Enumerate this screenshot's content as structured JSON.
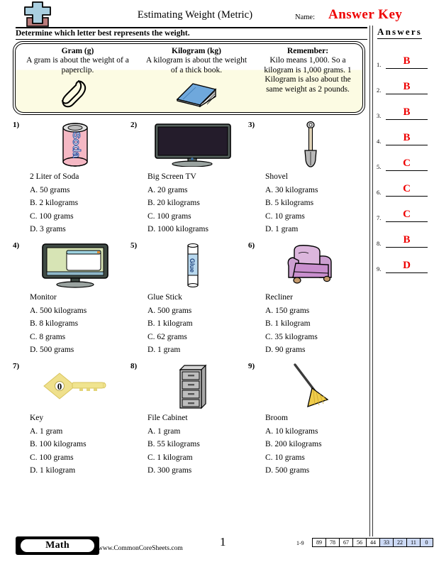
{
  "header": {
    "logo_icon": "plus-block-logo",
    "title": "Estimating Weight (Metric)",
    "name_label": "Name:",
    "answer_key_text": "Answer Key",
    "instruction": "Determine which letter best represents the weight."
  },
  "info_box": {
    "columns": [
      {
        "title": "Gram (g)",
        "text": "A gram is about the weight of a paperclip.",
        "art_icon": "paperclip-icon"
      },
      {
        "title": "Kilogram (kg)",
        "text": "A kilogram is about the weight of a thick book.",
        "art_icon": "book-icon"
      },
      {
        "title": "Remember:",
        "text": "Kilo means 1,000. So a kilogram is 1,000 grams. 1 Kilogram is also about the same weight as 2 pounds.",
        "art_icon": "none"
      }
    ]
  },
  "questions": [
    {
      "number": "1)",
      "art_icon": "soda-can-icon",
      "label": "2 Liter of Soda",
      "choices": [
        "A. 50 grams",
        "B. 2 kilograms",
        "C. 100 grams",
        "D. 3 grams"
      ]
    },
    {
      "number": "2)",
      "art_icon": "television-icon",
      "label": "Big Screen TV",
      "choices": [
        "A. 20 grams",
        "B. 20 kilograms",
        "C. 100 grams",
        "D. 1000 kilograms"
      ]
    },
    {
      "number": "3)",
      "art_icon": "shovel-icon",
      "label": "Shovel",
      "choices": [
        "A. 30 kilograms",
        "B. 5 kilograms",
        "C. 10 grams",
        "D. 1 gram"
      ]
    },
    {
      "number": "4)",
      "art_icon": "monitor-icon",
      "label": "Monitor",
      "choices": [
        "A. 500 kilograms",
        "B. 8 kilograms",
        "C. 8 grams",
        "D. 500 grams"
      ]
    },
    {
      "number": "5)",
      "art_icon": "glue-stick-icon",
      "label": "Glue Stick",
      "choices": [
        "A. 500 grams",
        "B. 1 kilogram",
        "C. 62 grams",
        "D. 1 gram"
      ]
    },
    {
      "number": "6)",
      "art_icon": "recliner-icon",
      "label": "Recliner",
      "choices": [
        "A. 150 grams",
        "B. 1 kilogram",
        "C. 35 kilograms",
        "D. 90 grams"
      ]
    },
    {
      "number": "7)",
      "art_icon": "key-icon",
      "label": "Key",
      "choices": [
        "A. 1 gram",
        "B. 100 kilograms",
        "C. 100 grams",
        "D. 1 kilogram"
      ]
    },
    {
      "number": "8)",
      "art_icon": "file-cabinet-icon",
      "label": "File Cabinet",
      "choices": [
        "A. 1 gram",
        "B. 55 kilograms",
        "C. 1 kilogram",
        "D. 300 grams"
      ]
    },
    {
      "number": "9)",
      "art_icon": "broom-icon",
      "label": "Broom",
      "choices": [
        "A. 10 kilograms",
        "B. 200 kilograms",
        "C. 10 grams",
        "D. 500 grams"
      ]
    }
  ],
  "answers": {
    "heading": "Answers",
    "items": [
      {
        "number": "1.",
        "letter": "B"
      },
      {
        "number": "2.",
        "letter": "B"
      },
      {
        "number": "3.",
        "letter": "B"
      },
      {
        "number": "4.",
        "letter": "B"
      },
      {
        "number": "5.",
        "letter": "C"
      },
      {
        "number": "6.",
        "letter": "C"
      },
      {
        "number": "7.",
        "letter": "C"
      },
      {
        "number": "8.",
        "letter": "B"
      },
      {
        "number": "9.",
        "letter": "D"
      }
    ]
  },
  "footer": {
    "subject": "Math",
    "url": "www.CommonCoreSheets.com",
    "page_number": "1",
    "scale_range": "1-9",
    "scale_values": [
      "89",
      "78",
      "67",
      "56",
      "44",
      "33",
      "22",
      "11",
      "0"
    ],
    "scale_highlight_from_index": 5
  },
  "colors": {
    "answer_red": "#ee0000",
    "info_bg": "#fcfbe3",
    "scale_highlight": "#ccd9f5"
  }
}
